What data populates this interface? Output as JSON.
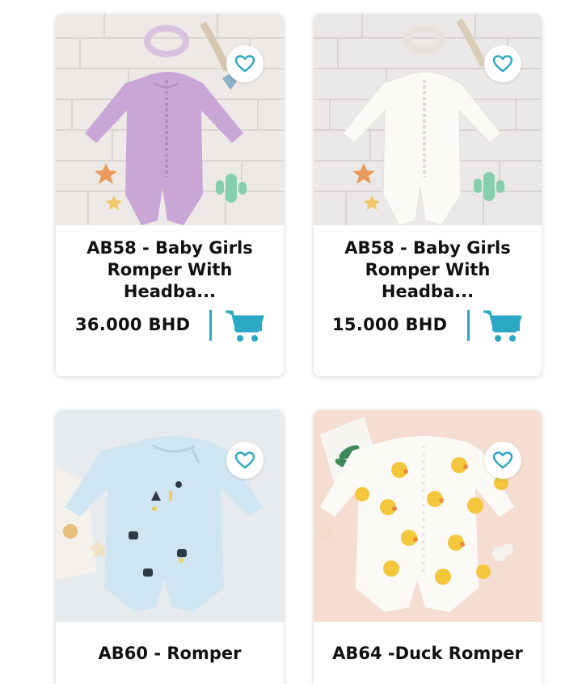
{
  "colors": {
    "accent": "#2BA8C4",
    "text": "#111111"
  },
  "products": [
    {
      "title": "AB58 - Baby Girls\nRomper With Headba...",
      "price": "36.000 BHD",
      "image": "lilac-ruffle-romper-with-headband",
      "favorite_icon": "heart-outline-icon",
      "cart_icon": "shopping-cart-icon"
    },
    {
      "title": "AB58 - Baby Girls\nRomper With Headba...",
      "price": "15.000 BHD",
      "image": "white-ruffle-romper-with-headband",
      "favorite_icon": "heart-outline-icon",
      "cart_icon": "shopping-cart-icon"
    },
    {
      "title": "AB60 - Romper",
      "image": "light-blue-printed-romper",
      "favorite_icon": "heart-outline-icon"
    },
    {
      "title": "AB64 -Duck Romper",
      "image": "white-duck-print-romper",
      "favorite_icon": "heart-outline-icon"
    }
  ]
}
